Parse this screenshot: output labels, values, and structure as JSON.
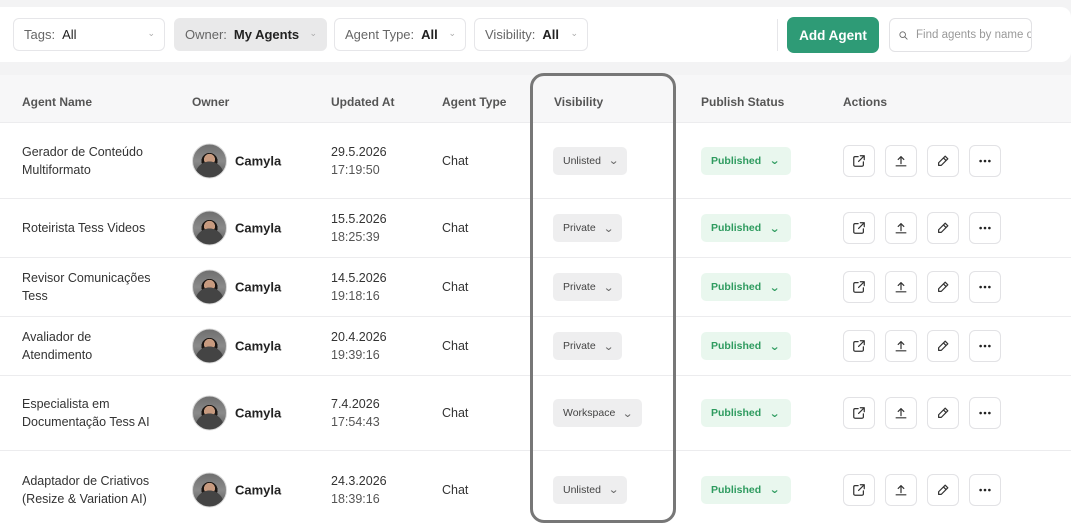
{
  "filters": {
    "tags": {
      "label": "Tags:",
      "value": "All"
    },
    "owner": {
      "label": "Owner:",
      "value": "My Agents"
    },
    "agent_type": {
      "label": "Agent Type:",
      "value": "All"
    },
    "visibility": {
      "label": "Visibility:",
      "value": "All"
    }
  },
  "add_button": "Add Agent",
  "search": {
    "placeholder": "Find agents by name or"
  },
  "columns": {
    "name": "Agent Name",
    "owner": "Owner",
    "updated": "Updated At",
    "type": "Agent Type",
    "visibility": "Visibility",
    "publish": "Publish Status",
    "actions": "Actions"
  },
  "rows": [
    {
      "name": "Gerador de Conteúdo Multiformato",
      "owner": "Camyla",
      "date": "29.5.2026",
      "time": "17:19:50",
      "type": "Chat",
      "visibility": "Unlisted",
      "status": "Published"
    },
    {
      "name": "Roteirista Tess Videos",
      "owner": "Camyla",
      "date": "15.5.2026",
      "time": "18:25:39",
      "type": "Chat",
      "visibility": "Private",
      "status": "Published"
    },
    {
      "name": "Revisor Comunicações Tess",
      "owner": "Camyla",
      "date": "14.5.2026",
      "time": "19:18:16",
      "type": "Chat",
      "visibility": "Private",
      "status": "Published"
    },
    {
      "name": "Avaliador de Atendimento",
      "owner": "Camyla",
      "date": "20.4.2026",
      "time": "19:39:16",
      "type": "Chat",
      "visibility": "Private",
      "status": "Published"
    },
    {
      "name": "Especialista em Documentação Tess AI",
      "owner": "Camyla",
      "date": "7.4.2026",
      "time": "17:54:43",
      "type": "Chat",
      "visibility": "Workspace",
      "status": "Published"
    },
    {
      "name": "Adaptador de Criativos (Resize & Variation AI)",
      "owner": "Camyla",
      "date": "24.3.2026",
      "time": "18:39:16",
      "type": "Chat",
      "visibility": "Unlisted",
      "status": "Published"
    }
  ],
  "icons": {
    "search": "search-icon",
    "chevron": "chevron-down-icon",
    "actions": [
      "external-link-icon",
      "upload-icon",
      "edit-icon",
      "more-icon"
    ]
  },
  "colors": {
    "primary": "#2e9b76",
    "published_bg": "#e9f7ee",
    "published_text": "#2e9b5f"
  }
}
